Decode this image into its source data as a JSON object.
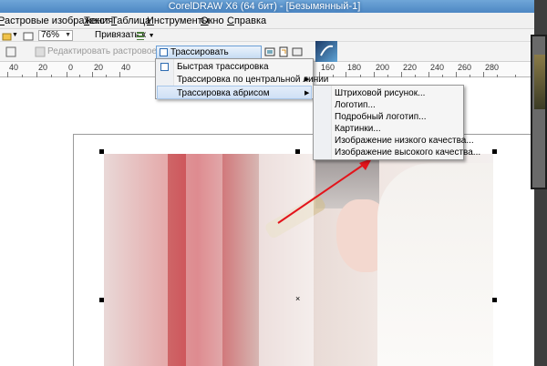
{
  "window": {
    "title": "CorelDRAW X6 (64 бит) - [Безымянный-1]"
  },
  "menubar": {
    "items": [
      "Растровые изображения",
      "Текст",
      "Таблица",
      "Инструменты",
      "Окно",
      "Справка"
    ]
  },
  "toolbar": {
    "zoom": "76%",
    "snap_label": "Привязать к"
  },
  "property_bar": {
    "edit_bitmap_label": "Редактировать растровое из...",
    "trace_button_label": "Трассировать растровое из."
  },
  "ruler": {
    "labels": [
      "40",
      "20",
      "0",
      "20",
      "40",
      "160",
      "180",
      "200",
      "220",
      "240",
      "260",
      "280"
    ]
  },
  "trace_menu": {
    "items": [
      {
        "label": "Быстрая трассировка",
        "has_submenu": false,
        "highlighted": false
      },
      {
        "label": "Трассировка по центральной линии",
        "has_submenu": true,
        "highlighted": false
      },
      {
        "label": "Трассировка абрисом",
        "has_submenu": true,
        "highlighted": true
      }
    ]
  },
  "outline_submenu": {
    "items": [
      "Штриховой рисунок...",
      "Логотип...",
      "Подробный логотип...",
      "Картинки...",
      "Изображение низкого качества...",
      "Изображение высокого качества..."
    ]
  },
  "canvas": {
    "center_mark": "×"
  },
  "colors": {
    "accent_blue": "#4d87c3",
    "arrow_red": "#e3141b",
    "highlight": "#cfe0f5"
  }
}
